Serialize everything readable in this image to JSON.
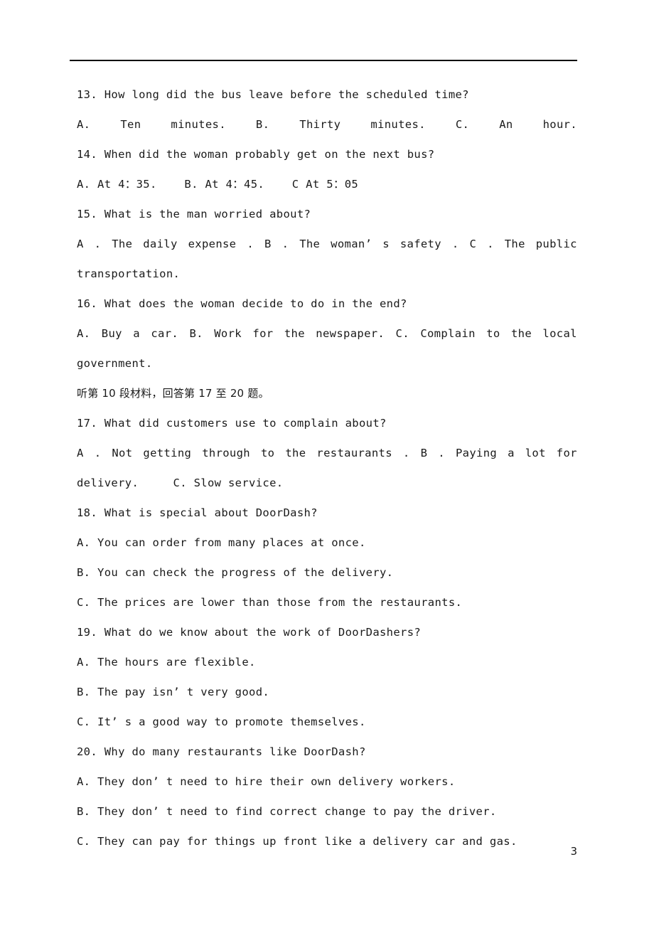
{
  "document": {
    "page_number": "3",
    "header_rule": true
  },
  "lines": [
    {
      "id": "q13-stem",
      "text": "13. How long did the bus leave before the scheduled time?",
      "mode": "plain"
    },
    {
      "id": "q13-options",
      "mode": "justify",
      "tokens": [
        "A.",
        "Ten",
        "minutes.",
        "B.",
        "Thirty",
        "minutes.",
        "C.",
        "An",
        "hour."
      ]
    },
    {
      "id": "q14-stem",
      "text": "14. When did the woman probably get on the next bus?",
      "mode": "plain"
    },
    {
      "id": "q14-options",
      "text": "A. At 4：35.    B. At 4：45.    C At 5：05",
      "mode": "plain"
    },
    {
      "id": "q15-stem",
      "text": "15. What is the man worried about?",
      "mode": "plain"
    },
    {
      "id": "q15-options",
      "mode": "justify",
      "tokens": [
        "A",
        ".",
        "The",
        "daily",
        "expense",
        ".",
        "B",
        ".",
        "The",
        "woman’",
        "s",
        "safety",
        ".",
        "C",
        ".",
        "The",
        "public"
      ]
    },
    {
      "id": "q15-cont",
      "text": "transportation.",
      "mode": "plain"
    },
    {
      "id": "q16-stem",
      "text": "16. What does the woman decide to do in the end?",
      "mode": "plain"
    },
    {
      "id": "q16-options",
      "mode": "justify",
      "tokens": [
        "A.",
        "Buy",
        "a",
        "car.",
        "B.",
        "Work",
        "for",
        "the",
        "newspaper.",
        "C.",
        "Complain",
        "to",
        "the",
        "local"
      ]
    },
    {
      "id": "q16-cont",
      "text": "government.",
      "mode": "plain"
    },
    {
      "id": "section-10",
      "text": "听第 10 段材料，回答第 17 至 20 题。",
      "mode": "cjk"
    },
    {
      "id": "q17-stem",
      "text": "17. What did customers use to complain about?",
      "mode": "plain"
    },
    {
      "id": "q17-options",
      "mode": "justify",
      "tokens": [
        "A",
        ".",
        "Not",
        "getting",
        "through",
        "to",
        "the",
        "restaurants",
        ".",
        "B",
        ".",
        "Paying",
        "a",
        "lot",
        "for"
      ]
    },
    {
      "id": "q17-cont",
      "text": "delivery.     C. Slow service.",
      "mode": "plain"
    },
    {
      "id": "q18-stem",
      "text": "18. What is special about DoorDash?",
      "mode": "plain"
    },
    {
      "id": "q18-a",
      "text": "A. You can order from many places at once.",
      "mode": "plain"
    },
    {
      "id": "q18-b",
      "text": "B. You can check the progress of the delivery.",
      "mode": "plain"
    },
    {
      "id": "q18-c",
      "text": "C. The prices are lower than those from the restaurants.",
      "mode": "plain"
    },
    {
      "id": "q19-stem",
      "text": "19. What do we know about the work of DoorDashers?",
      "mode": "plain"
    },
    {
      "id": "q19-a",
      "text": "A. The hours are flexible.",
      "mode": "plain"
    },
    {
      "id": "q19-b",
      "text": "B. The pay isn’ t very good.",
      "mode": "plain"
    },
    {
      "id": "q19-c",
      "text": "C. It’ s a good way to promote themselves.",
      "mode": "plain"
    },
    {
      "id": "q20-stem",
      "text": "20. Why do many restaurants like DoorDash?",
      "mode": "plain"
    },
    {
      "id": "q20-a",
      "text": "A. They don’ t need to hire their own delivery workers.",
      "mode": "plain"
    },
    {
      "id": "q20-b",
      "text": "B. They don’ t need to find correct change to pay the driver.",
      "mode": "plain"
    },
    {
      "id": "q20-c",
      "text": "C. They can pay for things up front like a delivery car and gas.",
      "mode": "plain"
    }
  ]
}
